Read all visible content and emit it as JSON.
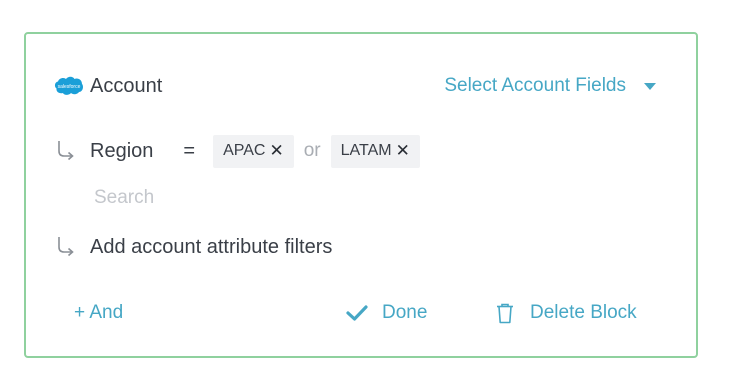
{
  "block": {
    "object_icon": "salesforce-cloud-icon",
    "object_label": "Account",
    "field_select_label": "Select Account Fields",
    "accent_color": "#46a7c5",
    "border_color": "#8fd19e"
  },
  "filter": {
    "field": "Region",
    "operator": "=",
    "values": [
      "APAC",
      "LATAM"
    ],
    "joiner": "or",
    "remove_glyph": "✕",
    "search_placeholder": "Search"
  },
  "add_filter_label": "Add account attribute filters",
  "footer": {
    "and_label": "+ And",
    "done_label": "Done",
    "delete_label": "Delete Block"
  }
}
